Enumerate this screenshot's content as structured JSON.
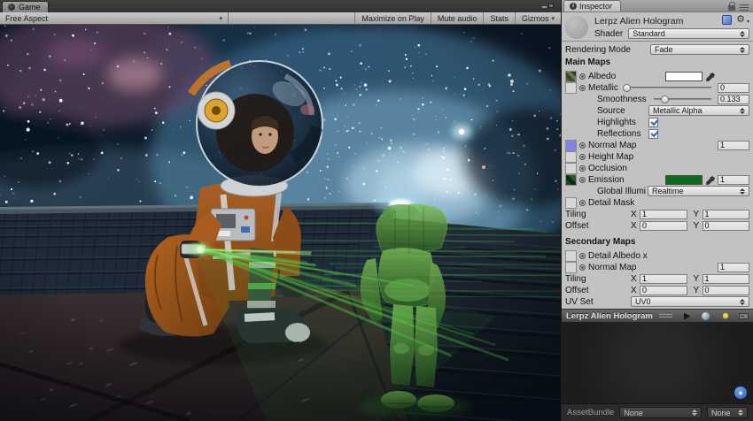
{
  "game_panel": {
    "tab_label": "Game",
    "toolbar": {
      "aspect_dropdown": "Free Aspect",
      "maximize_button": "Maximize on Play",
      "mute_button": "Mute audio",
      "stats_button": "Stats",
      "gizmos_button": "Gizmos"
    }
  },
  "inspector": {
    "tab_label": "Inspector",
    "header": {
      "material_name": "Lerpz Alien Hologram",
      "shader_label": "Shader",
      "shader_value": "Standard"
    },
    "rendering_mode": {
      "label": "Rendering Mode",
      "value": "Fade"
    },
    "main_maps": {
      "title": "Main Maps",
      "albedo": {
        "label": "Albedo"
      },
      "metallic": {
        "label": "Metallic",
        "value": "0"
      },
      "smoothness": {
        "label": "Smoothness",
        "value": "0.133"
      },
      "source": {
        "label": "Source",
        "value": "Metallic Alpha"
      },
      "highlights": {
        "label": "Highlights",
        "checked": true
      },
      "reflections": {
        "label": "Reflections",
        "checked": true
      },
      "normal_map": {
        "label": "Normal Map",
        "value": "1"
      },
      "height_map": {
        "label": "Height Map"
      },
      "occlusion": {
        "label": "Occlusion"
      },
      "emission": {
        "label": "Emission",
        "value": "1"
      },
      "global_illumination": {
        "label": "Global Illumi",
        "value": "Realtime"
      },
      "detail_mask": {
        "label": "Detail Mask"
      },
      "tiling": {
        "label": "Tiling",
        "x": "1",
        "y": "1"
      },
      "offset": {
        "label": "Offset",
        "x": "0",
        "y": "0"
      }
    },
    "secondary_maps": {
      "title": "Secondary Maps",
      "detail_albedo": {
        "label": "Detail Albedo x"
      },
      "normal_map": {
        "label": "Normal Map",
        "value": "1"
      },
      "tiling": {
        "label": "Tiling",
        "x": "1",
        "y": "1"
      },
      "offset": {
        "label": "Offset",
        "x": "0",
        "y": "0"
      },
      "uv_set": {
        "label": "UV Set",
        "value": "UV0"
      }
    },
    "preview": {
      "title": "Lerpz Alien Hologram"
    },
    "assetbundle": {
      "label": "AssetBundle",
      "bundle_value": "None",
      "variant_value": "None"
    }
  },
  "labels": {
    "x": "X",
    "y": "Y"
  },
  "icons": {
    "info": "i",
    "gear": "⚙",
    "play": "▶",
    "tag": "◆",
    "caret": "▾"
  },
  "colors": {
    "emission_green": "#0E6B1E",
    "normal_map_blue": "#8184E6",
    "hologram_green": "#55C742",
    "suit_orange": "#A85C1E",
    "checkbox_blue": "#3465A8",
    "nebula_teal": "#7FB4D2"
  }
}
